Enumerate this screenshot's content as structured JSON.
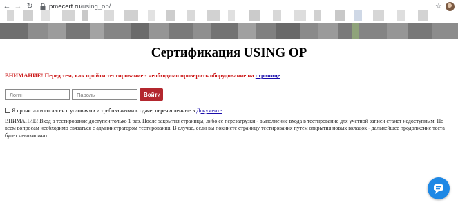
{
  "browser": {
    "url_domain": "pmecert.ru",
    "url_path": "/using_op/",
    "back_icon": "arrow-left-icon",
    "forward_icon": "arrow-right-icon",
    "reload_icon": "reload-icon",
    "lock_icon": "lock-icon",
    "star_icon": "star-icon"
  },
  "page": {
    "title": "Сертификация USING OP",
    "warning_text": "ВНИМАНИЕ! Перед тем, как пройти тестирование - необходимо проверить оборудование на ",
    "warning_link": "странице",
    "warning_color": "#cc1b1b"
  },
  "login_form": {
    "login_placeholder": "Логин",
    "password_placeholder": "Пароль",
    "submit_label": "Войти",
    "submit_color": "#b3272e"
  },
  "agreement": {
    "text": "Я прочитал и согласен с условиями и требованиями к сдаче, перечисленные в ",
    "link": "Документе",
    "checked": false
  },
  "notice": {
    "text": "ВНИМАНИЕ! Вход в тестирование доступен только 1 раз. После закрытия страницы, либо ее перезагрузки - выполнение входа в тестирование для учетной записи станет недоступным. По всем вопросам необходимо связаться с администратором тестирования. В случае, если вы покинете страницу тестирования путем открытия новых вкладок - дальнейшее продолжение теста будет невозможно."
  },
  "chat_widget": {
    "icon": "chat-bubble-icon",
    "color": "#1e88e5"
  }
}
